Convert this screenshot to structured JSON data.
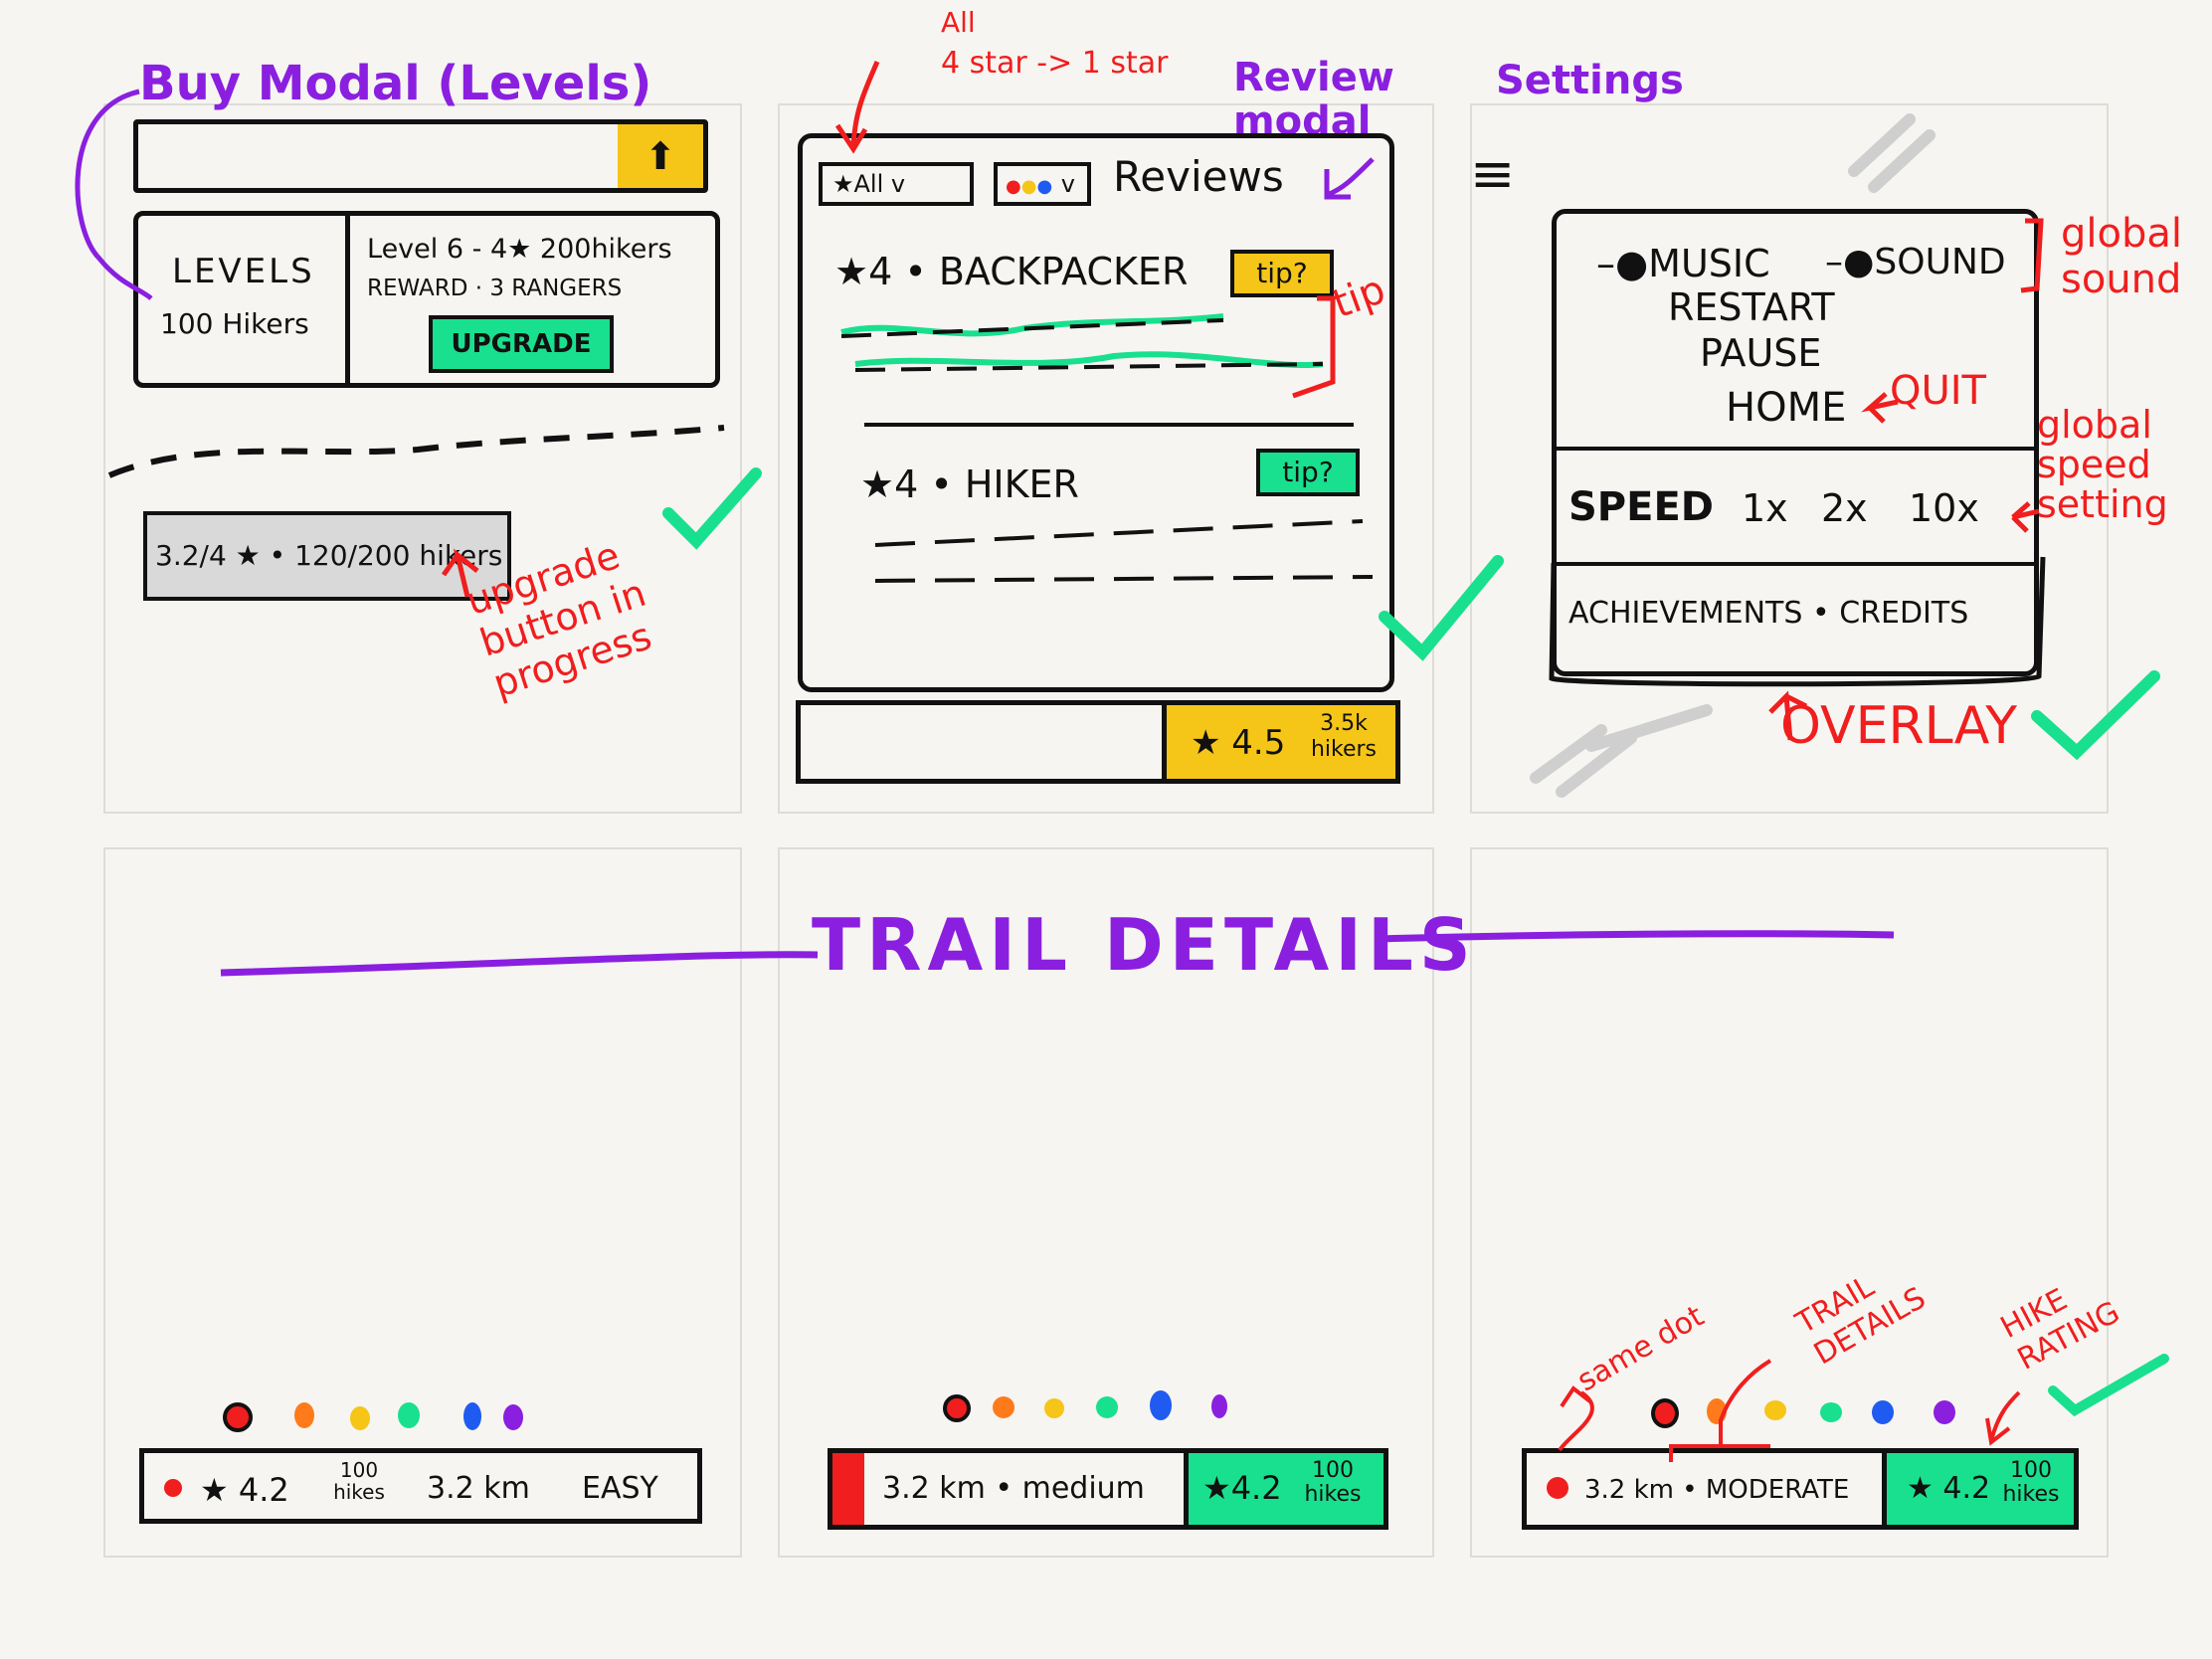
{
  "colors": {
    "ink": "#111111",
    "purple": "#8a1fe0",
    "red": "#f01e1e",
    "green": "#19e08e",
    "yellow": "#f5c518",
    "orange": "#ff7a1a",
    "blue": "#1f5bf0",
    "gray": "#d9d9d9"
  },
  "buy_modal": {
    "title": "Buy Modal (Levels)",
    "levels_label": "LEVELS",
    "hikers_label": "100 Hikers",
    "level_info": "Level 6 - 4★ 200hikers",
    "reward": "REWARD · 3 RANGERS",
    "upgrade": "UPGRADE",
    "progress_bar": "3.2/4 ★ • 120/200 hikers",
    "note": "upgrade button in progress"
  },
  "review_modal": {
    "title": "Review modal",
    "note_all": "All",
    "note_stars": "4 star -> 1 star",
    "filter_all": "★All v",
    "filter_color": "v",
    "heading": "Reviews",
    "review1": "★4 • BACKPACKER",
    "review2": "★4 • HIKER",
    "tip": "tip?",
    "tip_note": "tip",
    "footer_rating": "★ 4.5",
    "footer_hikers": "3.5k hikers"
  },
  "settings": {
    "title": "Settings",
    "music": "MUSIC",
    "sound": "SOUND",
    "restart": "RESTART",
    "pause": "PAUSE",
    "home": "HOME",
    "quit": "QUIT",
    "speed": "SPEED",
    "s1": "1x",
    "s2": "2x",
    "s3": "10x",
    "bottom": "ACHIEVEMENTS • CREDITS",
    "global_sound": "global sound",
    "global_speed": "global speed setting",
    "overlay": "OVERLAY"
  },
  "trail_details": {
    "title": "TRAIL DETAILS",
    "bar1": {
      "rating": "★ 4.2",
      "hikes": "100 hikes",
      "dist": "3.2 km",
      "diff": "EASY"
    },
    "bar2": {
      "text": "3.2 km • medium",
      "rating": "★4.2",
      "hikes": "100 hikes"
    },
    "bar3": {
      "text": "3.2 km • MODERATE",
      "rating": "★ 4.2",
      "hikes": "100 hikes"
    },
    "note_same": "same dot",
    "note_trail": "TRAIL DETAILS",
    "note_rating": "HIKE RATING"
  }
}
